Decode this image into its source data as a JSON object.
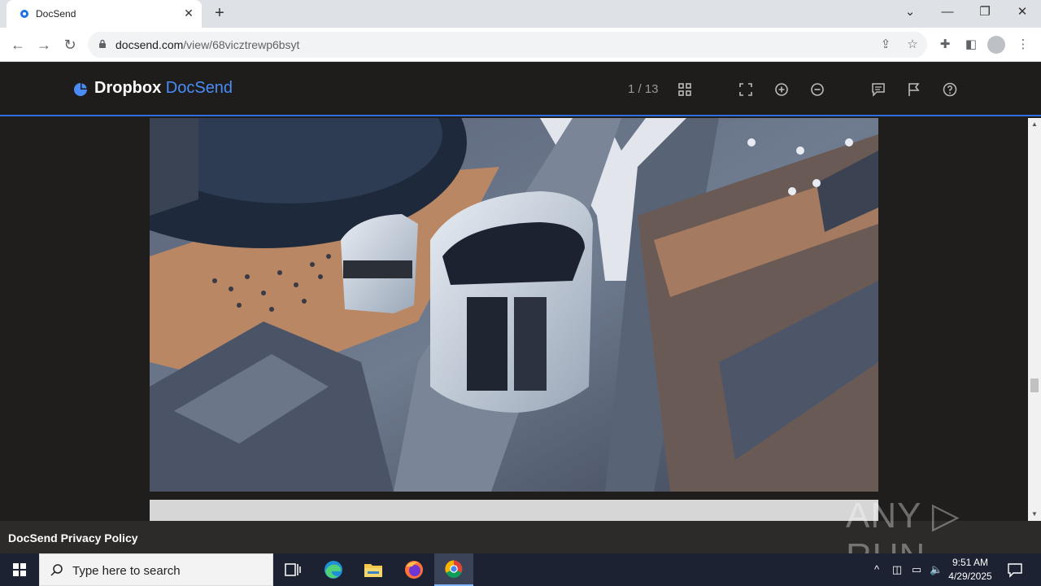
{
  "browser": {
    "tab_title": "DocSend",
    "url_domain": "docsend.com",
    "url_path": "/view/68vicztrewp6bsyt"
  },
  "docsend": {
    "brand_primary": "Dropbox",
    "brand_secondary": "DocSend",
    "page_indicator": "1 / 13",
    "accent_color": "#4a8cf7"
  },
  "footer": {
    "privacy_link": "DocSend Privacy Policy"
  },
  "watermark": "ANY ▷ RUN",
  "taskbar": {
    "search_placeholder": "Type here to search",
    "time": "9:51 AM",
    "date": "4/29/2025"
  }
}
